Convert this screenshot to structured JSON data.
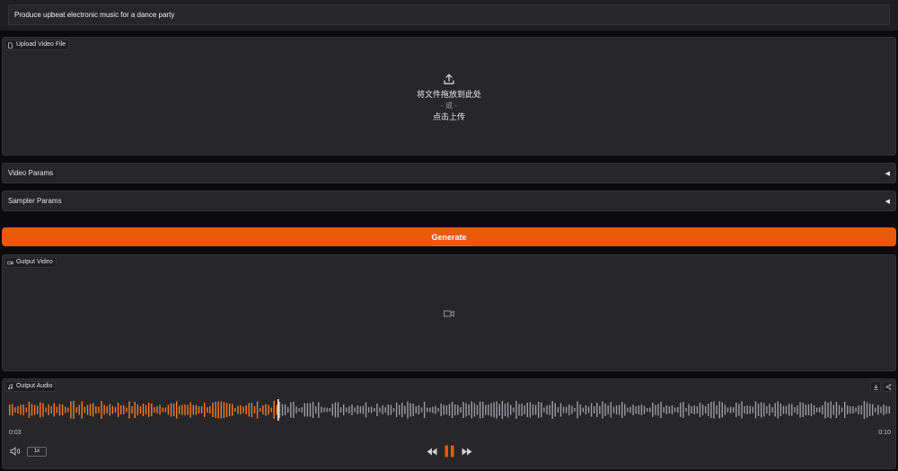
{
  "prompt": {
    "value": "Produce upbeat electronic music for a dance party"
  },
  "upload": {
    "label": "Upload Video File",
    "drop_text": "将文件拖放到此处",
    "or_text": "- 或 -",
    "click_text": "点击上传",
    "icon": "upload-icon"
  },
  "accordions": {
    "video_params": "Video Params",
    "sampler_params": "Sampler Params"
  },
  "generate": {
    "label": "Generate"
  },
  "output_video": {
    "label": "Output Video",
    "icon": "video-camera-icon"
  },
  "output_audio": {
    "label": "Output Audio",
    "current_time": "0:03",
    "duration": "0:10",
    "speed": "1x",
    "progress": 0.305
  },
  "colors": {
    "accent": "#ea580c",
    "wave_played": "#f07c2a",
    "wave_unplayed": "#9c9ca3",
    "background": "#0b0b0f",
    "panel": "#27272a"
  }
}
